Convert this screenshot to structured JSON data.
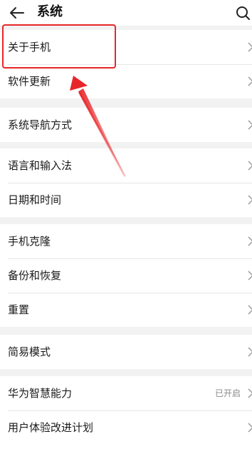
{
  "header": {
    "title": "系统",
    "back_icon": "arrow-left-icon",
    "search_icon": "search-icon"
  },
  "groups": [
    {
      "items": [
        {
          "label": "关于手机"
        },
        {
          "label": "软件更新"
        }
      ]
    },
    {
      "items": [
        {
          "label": "系统导航方式"
        }
      ]
    },
    {
      "items": [
        {
          "label": "语言和输入法"
        },
        {
          "label": "日期和时间"
        }
      ]
    },
    {
      "items": [
        {
          "label": "手机克隆"
        },
        {
          "label": "备份和恢复"
        },
        {
          "label": "重置"
        }
      ]
    },
    {
      "items": [
        {
          "label": "简易模式"
        }
      ]
    },
    {
      "items": [
        {
          "label": "华为智慧能力",
          "value": "已开启"
        },
        {
          "label": "用户体验改进计划"
        }
      ]
    }
  ],
  "annotation": {
    "color": "#e8262a"
  }
}
